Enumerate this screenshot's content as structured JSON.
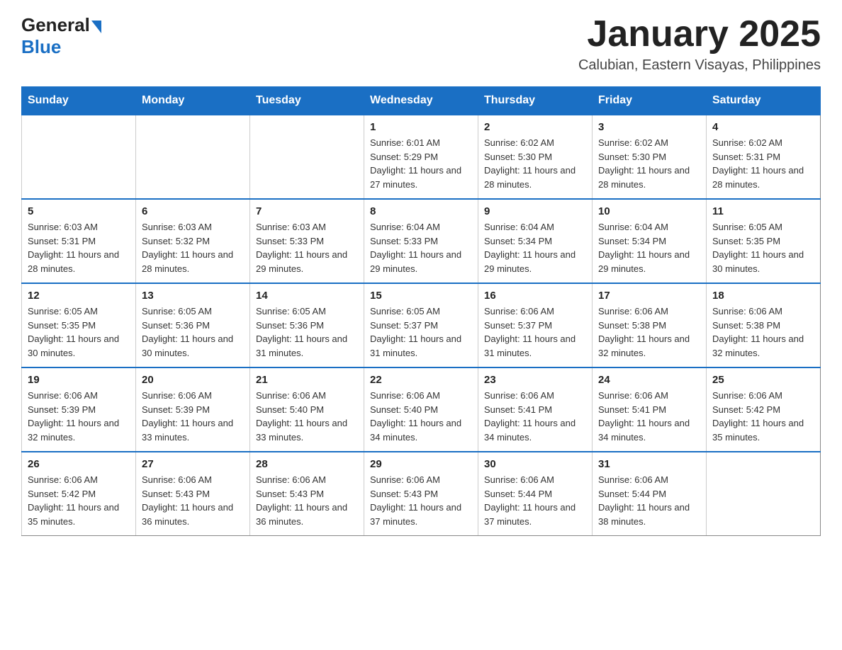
{
  "logo": {
    "text_general": "General",
    "text_blue": "Blue"
  },
  "title": "January 2025",
  "subtitle": "Calubian, Eastern Visayas, Philippines",
  "days_of_week": [
    "Sunday",
    "Monday",
    "Tuesday",
    "Wednesday",
    "Thursday",
    "Friday",
    "Saturday"
  ],
  "weeks": [
    [
      {
        "day": "",
        "info": ""
      },
      {
        "day": "",
        "info": ""
      },
      {
        "day": "",
        "info": ""
      },
      {
        "day": "1",
        "info": "Sunrise: 6:01 AM\nSunset: 5:29 PM\nDaylight: 11 hours and 27 minutes."
      },
      {
        "day": "2",
        "info": "Sunrise: 6:02 AM\nSunset: 5:30 PM\nDaylight: 11 hours and 28 minutes."
      },
      {
        "day": "3",
        "info": "Sunrise: 6:02 AM\nSunset: 5:30 PM\nDaylight: 11 hours and 28 minutes."
      },
      {
        "day": "4",
        "info": "Sunrise: 6:02 AM\nSunset: 5:31 PM\nDaylight: 11 hours and 28 minutes."
      }
    ],
    [
      {
        "day": "5",
        "info": "Sunrise: 6:03 AM\nSunset: 5:31 PM\nDaylight: 11 hours and 28 minutes."
      },
      {
        "day": "6",
        "info": "Sunrise: 6:03 AM\nSunset: 5:32 PM\nDaylight: 11 hours and 28 minutes."
      },
      {
        "day": "7",
        "info": "Sunrise: 6:03 AM\nSunset: 5:33 PM\nDaylight: 11 hours and 29 minutes."
      },
      {
        "day": "8",
        "info": "Sunrise: 6:04 AM\nSunset: 5:33 PM\nDaylight: 11 hours and 29 minutes."
      },
      {
        "day": "9",
        "info": "Sunrise: 6:04 AM\nSunset: 5:34 PM\nDaylight: 11 hours and 29 minutes."
      },
      {
        "day": "10",
        "info": "Sunrise: 6:04 AM\nSunset: 5:34 PM\nDaylight: 11 hours and 29 minutes."
      },
      {
        "day": "11",
        "info": "Sunrise: 6:05 AM\nSunset: 5:35 PM\nDaylight: 11 hours and 30 minutes."
      }
    ],
    [
      {
        "day": "12",
        "info": "Sunrise: 6:05 AM\nSunset: 5:35 PM\nDaylight: 11 hours and 30 minutes."
      },
      {
        "day": "13",
        "info": "Sunrise: 6:05 AM\nSunset: 5:36 PM\nDaylight: 11 hours and 30 minutes."
      },
      {
        "day": "14",
        "info": "Sunrise: 6:05 AM\nSunset: 5:36 PM\nDaylight: 11 hours and 31 minutes."
      },
      {
        "day": "15",
        "info": "Sunrise: 6:05 AM\nSunset: 5:37 PM\nDaylight: 11 hours and 31 minutes."
      },
      {
        "day": "16",
        "info": "Sunrise: 6:06 AM\nSunset: 5:37 PM\nDaylight: 11 hours and 31 minutes."
      },
      {
        "day": "17",
        "info": "Sunrise: 6:06 AM\nSunset: 5:38 PM\nDaylight: 11 hours and 32 minutes."
      },
      {
        "day": "18",
        "info": "Sunrise: 6:06 AM\nSunset: 5:38 PM\nDaylight: 11 hours and 32 minutes."
      }
    ],
    [
      {
        "day": "19",
        "info": "Sunrise: 6:06 AM\nSunset: 5:39 PM\nDaylight: 11 hours and 32 minutes."
      },
      {
        "day": "20",
        "info": "Sunrise: 6:06 AM\nSunset: 5:39 PM\nDaylight: 11 hours and 33 minutes."
      },
      {
        "day": "21",
        "info": "Sunrise: 6:06 AM\nSunset: 5:40 PM\nDaylight: 11 hours and 33 minutes."
      },
      {
        "day": "22",
        "info": "Sunrise: 6:06 AM\nSunset: 5:40 PM\nDaylight: 11 hours and 34 minutes."
      },
      {
        "day": "23",
        "info": "Sunrise: 6:06 AM\nSunset: 5:41 PM\nDaylight: 11 hours and 34 minutes."
      },
      {
        "day": "24",
        "info": "Sunrise: 6:06 AM\nSunset: 5:41 PM\nDaylight: 11 hours and 34 minutes."
      },
      {
        "day": "25",
        "info": "Sunrise: 6:06 AM\nSunset: 5:42 PM\nDaylight: 11 hours and 35 minutes."
      }
    ],
    [
      {
        "day": "26",
        "info": "Sunrise: 6:06 AM\nSunset: 5:42 PM\nDaylight: 11 hours and 35 minutes."
      },
      {
        "day": "27",
        "info": "Sunrise: 6:06 AM\nSunset: 5:43 PM\nDaylight: 11 hours and 36 minutes."
      },
      {
        "day": "28",
        "info": "Sunrise: 6:06 AM\nSunset: 5:43 PM\nDaylight: 11 hours and 36 minutes."
      },
      {
        "day": "29",
        "info": "Sunrise: 6:06 AM\nSunset: 5:43 PM\nDaylight: 11 hours and 37 minutes."
      },
      {
        "day": "30",
        "info": "Sunrise: 6:06 AM\nSunset: 5:44 PM\nDaylight: 11 hours and 37 minutes."
      },
      {
        "day": "31",
        "info": "Sunrise: 6:06 AM\nSunset: 5:44 PM\nDaylight: 11 hours and 38 minutes."
      },
      {
        "day": "",
        "info": ""
      }
    ]
  ]
}
